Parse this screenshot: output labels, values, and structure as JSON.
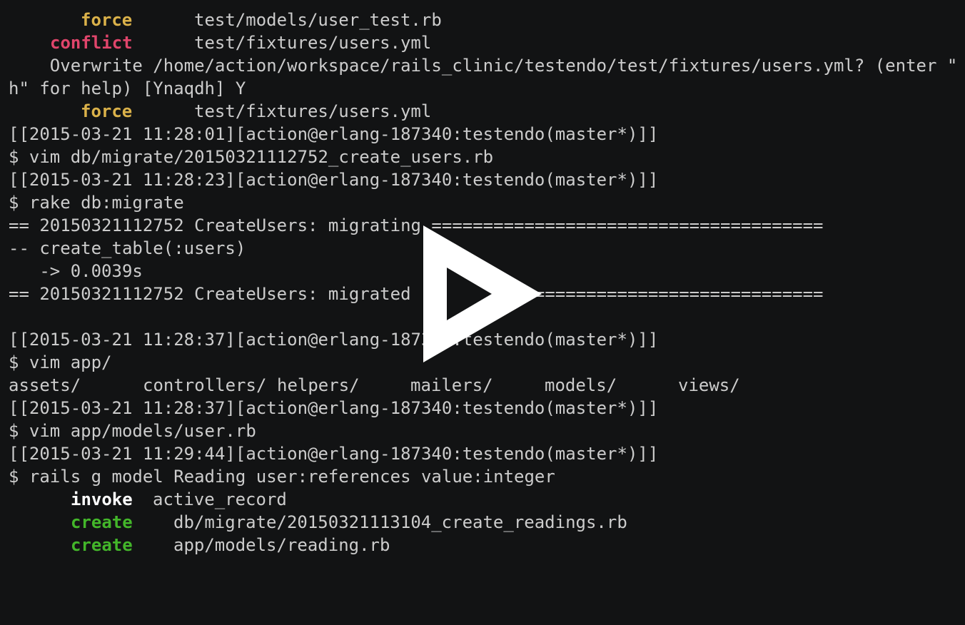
{
  "terminal": {
    "lines": [
      {
        "kind": "action",
        "tag": "force",
        "tag_color": "#dbb24a",
        "text": "test/models/user_test.rb"
      },
      {
        "kind": "action",
        "tag": "conflict",
        "tag_color": "#e0456b",
        "text": "test/fixtures/users.yml"
      },
      {
        "kind": "output",
        "text": "    Overwrite /home/action/workspace/rails_clinic/testendo/test/fixtures/users.yml? (enter \""
      },
      {
        "kind": "output",
        "text": "h\" for help) [Ynaqdh] Y"
      },
      {
        "kind": "action",
        "tag": "force",
        "tag_color": "#dbb24a",
        "text": "test/fixtures/users.yml"
      },
      {
        "kind": "prompt",
        "text": "[[2015-03-21 11:28:01][action@erlang-187340:testendo(master*)]]"
      },
      {
        "kind": "command",
        "text": "$ vim db/migrate/20150321112752_create_users.rb"
      },
      {
        "kind": "prompt",
        "text": "[[2015-03-21 11:28:23][action@erlang-187340:testendo(master*)]]"
      },
      {
        "kind": "command",
        "text": "$ rake db:migrate"
      },
      {
        "kind": "output",
        "text": "== 20150321112752 CreateUsers: migrating ======================================"
      },
      {
        "kind": "output",
        "text": "-- create_table(:users)"
      },
      {
        "kind": "output",
        "text": "   -> 0.0039s"
      },
      {
        "kind": "output",
        "text": "== 20150321112752 CreateUsers: migrated (0.0040s) ============================="
      },
      {
        "kind": "output",
        "text": ""
      },
      {
        "kind": "prompt",
        "text": "[[2015-03-21 11:28:37][action@erlang-187340:testendo(master*)]]"
      },
      {
        "kind": "command",
        "text": "$ vim app/"
      },
      {
        "kind": "completion",
        "items": [
          "assets/",
          "controllers/",
          "helpers/",
          "mailers/",
          "models/",
          "views/"
        ]
      },
      {
        "kind": "prompt",
        "text": "[[2015-03-21 11:28:37][action@erlang-187340:testendo(master*)]]"
      },
      {
        "kind": "command",
        "text": "$ vim app/models/user.rb"
      },
      {
        "kind": "prompt",
        "text": "[[2015-03-21 11:29:44][action@erlang-187340:testendo(master*)]]"
      },
      {
        "kind": "command",
        "text": "$ rails g model Reading user:references value:integer"
      },
      {
        "kind": "action",
        "tag": "invoke",
        "tag_color": "#ffffff",
        "text": "active_record"
      },
      {
        "kind": "action",
        "tag": "create",
        "tag_color": "#43b62a",
        "text": "db/migrate/20150321113104_create_readings.rb"
      },
      {
        "kind": "action",
        "tag": "create",
        "tag_color": "#43b62a",
        "text": "app/models/reading.rb"
      }
    ]
  },
  "player": {
    "play_icon": "play-icon"
  },
  "colors": {
    "background": "#121314",
    "foreground": "#cccccc",
    "force": "#dbb24a",
    "conflict": "#e0456b",
    "invoke": "#ffffff",
    "create": "#43b62a"
  }
}
